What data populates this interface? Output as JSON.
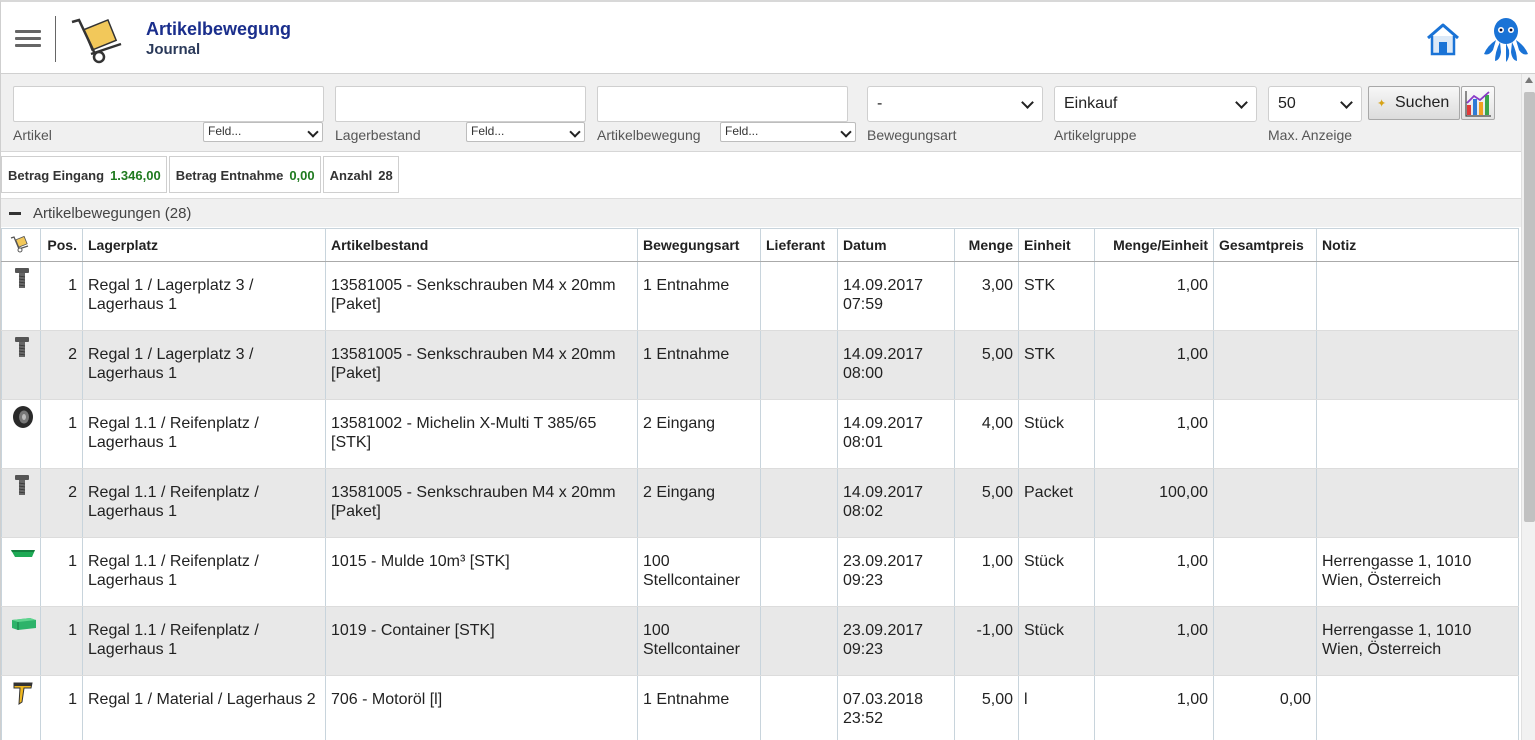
{
  "header": {
    "title": "Artikelbewegung",
    "subtitle": "Journal",
    "icons": [
      "menu-icon",
      "hand-truck-icon",
      "home-icon",
      "octopus-icon"
    ]
  },
  "filters": {
    "artikel": {
      "value": "",
      "label": "Artikel",
      "field_select": "Feld..."
    },
    "lagerbestand": {
      "value": "",
      "label": "Lagerbestand",
      "field_select": "Feld..."
    },
    "artikelbewegung": {
      "value": "",
      "label": "Artikelbewegung",
      "field_select": "Feld..."
    },
    "bewegungsart": {
      "value": "-",
      "label": "Bewegungsart"
    },
    "artikelgruppe": {
      "value": "Einkauf",
      "label": "Artikelgruppe"
    },
    "max_anzeige": {
      "value": "50",
      "label": "Max. Anzeige"
    },
    "search_label": "Suchen"
  },
  "summary": {
    "eingang_label": "Betrag Eingang",
    "eingang_value": "1.346,00",
    "entnahme_label": "Betrag Entnahme",
    "entnahme_value": "0,00",
    "anzahl_label": "Anzahl",
    "anzahl_value": "28"
  },
  "group": {
    "label": "Artikelbewegungen (28)"
  },
  "table": {
    "headers": [
      "Pos.",
      "Lagerplatz",
      "Artikelbestand",
      "Bewegungsart",
      "Lieferant",
      "Datum",
      "Menge",
      "Einheit",
      "Menge/Einheit",
      "Gesamtpreis",
      "Notiz"
    ],
    "rows": [
      {
        "icon": "screw-icon",
        "pos": "1",
        "lagerplatz": "Regal 1 / Lagerplatz 3 / Lagerhaus 1",
        "artikel": "13581005 - Senkschrauben M4 x 20mm [Paket]",
        "bewegungsart": "1 Entnahme",
        "lieferant": "",
        "datum": "14.09.2017 07:59",
        "menge": "3,00",
        "einheit": "STK",
        "menge_einheit": "1,00",
        "gesamtpreis": "",
        "notiz": ""
      },
      {
        "icon": "screw-icon",
        "pos": "2",
        "lagerplatz": "Regal 1 / Lagerplatz 3 / Lagerhaus 1",
        "artikel": "13581005 - Senkschrauben M4 x 20mm [Paket]",
        "bewegungsart": "1 Entnahme",
        "lieferant": "",
        "datum": "14.09.2017 08:00",
        "menge": "5,00",
        "einheit": "STK",
        "menge_einheit": "1,00",
        "gesamtpreis": "",
        "notiz": ""
      },
      {
        "icon": "tire-icon",
        "pos": "1",
        "lagerplatz": "Regal 1.1 / Reifenplatz / Lagerhaus 1",
        "artikel": "13581002 - Michelin X-Multi T 385/65 [STK]",
        "bewegungsart": "2 Eingang",
        "lieferant": "",
        "datum": "14.09.2017 08:01",
        "menge": "4,00",
        "einheit": "Stück",
        "menge_einheit": "1,00",
        "gesamtpreis": "",
        "notiz": ""
      },
      {
        "icon": "screw-icon",
        "pos": "2",
        "lagerplatz": "Regal 1.1 / Reifenplatz / Lagerhaus 1",
        "artikel": "13581005 - Senkschrauben M4 x 20mm [Paket]",
        "bewegungsart": "2 Eingang",
        "lieferant": "",
        "datum": "14.09.2017 08:02",
        "menge": "5,00",
        "einheit": "Packet",
        "menge_einheit": "100,00",
        "gesamtpreis": "",
        "notiz": ""
      },
      {
        "icon": "dumpster-icon",
        "pos": "1",
        "lagerplatz": "Regal 1.1 / Reifenplatz / Lagerhaus 1",
        "artikel": "1015 - Mulde 10m³ [STK]",
        "bewegungsart": "100 Stellcontainer",
        "lieferant": "",
        "datum": "23.09.2017 09:23",
        "menge": "1,00",
        "einheit": "Stück",
        "menge_einheit": "1,00",
        "gesamtpreis": "",
        "notiz": "Herrengasse 1, 1010 Wien, Österreich"
      },
      {
        "icon": "container-icon",
        "pos": "1",
        "lagerplatz": "Regal 1.1 / Reifenplatz / Lagerhaus 1",
        "artikel": "1019 - Container [STK]",
        "bewegungsart": "100 Stellcontainer",
        "lieferant": "",
        "datum": "23.09.2017 09:23",
        "menge": "-1,00",
        "einheit": "Stück",
        "menge_einheit": "1,00",
        "gesamtpreis": "",
        "notiz": "Herrengasse 1, 1010 Wien, Österreich"
      },
      {
        "icon": "oil-icon",
        "pos": "1",
        "lagerplatz": "Regal 1 / Material / Lagerhaus 2",
        "artikel": "706 - Motoröl [l]",
        "bewegungsart": "1 Entnahme",
        "lieferant": "",
        "datum": "07.03.2018 23:52",
        "menge": "5,00",
        "einheit": "l",
        "menge_einheit": "1,00",
        "gesamtpreis": "0,00",
        "notiz": ""
      }
    ]
  },
  "colors": {
    "title": "#1a2e8c",
    "brand": "#1a73d6",
    "positive": "#1f7a1f",
    "alt_row": "#e8e8e8"
  }
}
